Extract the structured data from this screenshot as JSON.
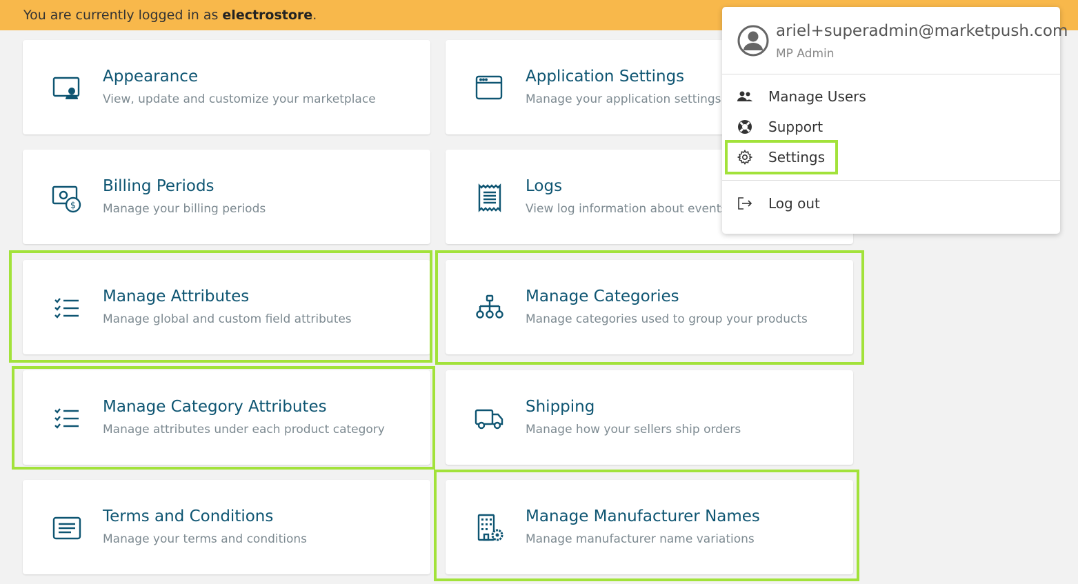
{
  "banner": {
    "prefix": "You are currently logged in as ",
    "user": "electrostore",
    "suffix": "."
  },
  "cards": [
    {
      "title": "Appearance",
      "subtitle": "View, update and customize your marketplace",
      "icon": "appearance-icon"
    },
    {
      "title": "Application Settings",
      "subtitle": "Manage your application settings",
      "icon": "browser-window-icon"
    },
    {
      "title": "Billing Periods",
      "subtitle": "Manage your billing periods",
      "icon": "money-dollar-icon"
    },
    {
      "title": "Logs",
      "subtitle": "View log information about events triggered",
      "icon": "receipt-icon"
    },
    {
      "title": "Manage Attributes",
      "subtitle": "Manage global and custom field attributes",
      "icon": "checklist-icon"
    },
    {
      "title": "Manage Categories",
      "subtitle": "Manage categories used to group your products",
      "icon": "hierarchy-icon"
    },
    {
      "title": "Manage Category Attributes",
      "subtitle": "Manage attributes under each product category",
      "icon": "checklist-icon"
    },
    {
      "title": "Shipping",
      "subtitle": "Manage how your sellers ship orders",
      "icon": "truck-icon"
    },
    {
      "title": "Terms and Conditions",
      "subtitle": "Manage your terms and conditions",
      "icon": "document-icon"
    },
    {
      "title": "Manage Manufacturer Names",
      "subtitle": "Manage manufacturer name variations",
      "icon": "building-gear-icon"
    }
  ],
  "user_menu": {
    "email": "ariel+superadmin@marketpush.com",
    "role": "MP Admin",
    "items": [
      {
        "label": "Manage Users",
        "icon": "users-icon"
      },
      {
        "label": "Support",
        "icon": "lifebuoy-icon"
      },
      {
        "label": "Settings",
        "icon": "gear-icon"
      },
      {
        "label": "Log out",
        "icon": "logout-icon"
      }
    ]
  },
  "colors": {
    "banner": "#f8b84b",
    "accent": "#0e5572",
    "highlight": "#a2e23a"
  }
}
